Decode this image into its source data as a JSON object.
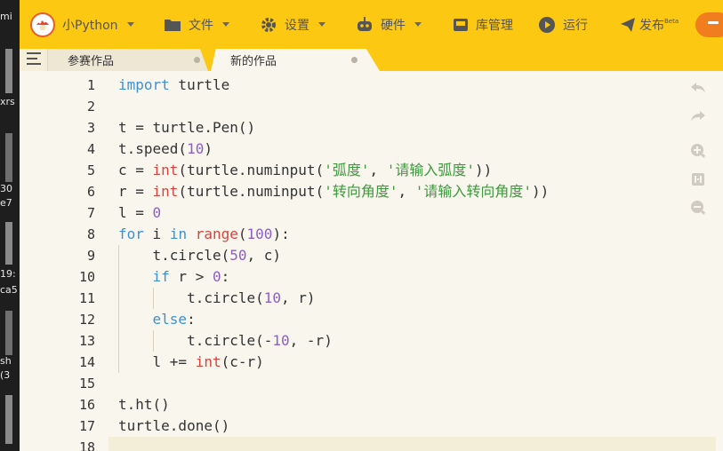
{
  "desktop_strip": {
    "texts": [
      "mi",
      "xrs",
      "30",
      "e7",
      "19:",
      "ca5",
      "sh",
      "(3"
    ]
  },
  "menu": {
    "brand": "小Python",
    "file": "文件",
    "settings": "设置",
    "hardware": "硬件",
    "library": "库管理",
    "run": "运行",
    "publish": "发布",
    "publish_badge": "Beta"
  },
  "tabs": [
    {
      "label": "参赛作品"
    },
    {
      "label": "新的作品"
    }
  ],
  "editor": {
    "line_numbers": [
      "1",
      "2",
      "3",
      "4",
      "5",
      "6",
      "7",
      "8",
      "9",
      "10",
      "11",
      "12",
      "13",
      "14",
      "15",
      "16",
      "17",
      "18"
    ],
    "lines": [
      "import turtle",
      "",
      "t = turtle.Pen()",
      "t.speed(10)",
      "c = int(turtle.numinput('弧度', '请输入弧度'))",
      "r = int(turtle.numinput('转向角度', '请输入转向角度'))",
      "l = 0",
      "for i in range(100):",
      "    t.circle(50, c)",
      "    if r > 0:",
      "        t.circle(10, r)",
      "    else:",
      "        t.circle(-10, -r)",
      "    l += int(c-r)",
      "",
      "t.ht()",
      "turtle.done()",
      ""
    ]
  },
  "tools": [
    "undo-icon",
    "redo-icon",
    "zoom-in-icon",
    "reset-zoom-icon",
    "zoom-out-icon"
  ],
  "colors": {
    "topbar": "#fcc812",
    "editor_bg": "#f9f6ee",
    "keyword_blue": "#3e8fd6",
    "builtin_red": "#d6443d",
    "number_purple": "#8a5fc9",
    "string_green": "#3b9a3b"
  }
}
